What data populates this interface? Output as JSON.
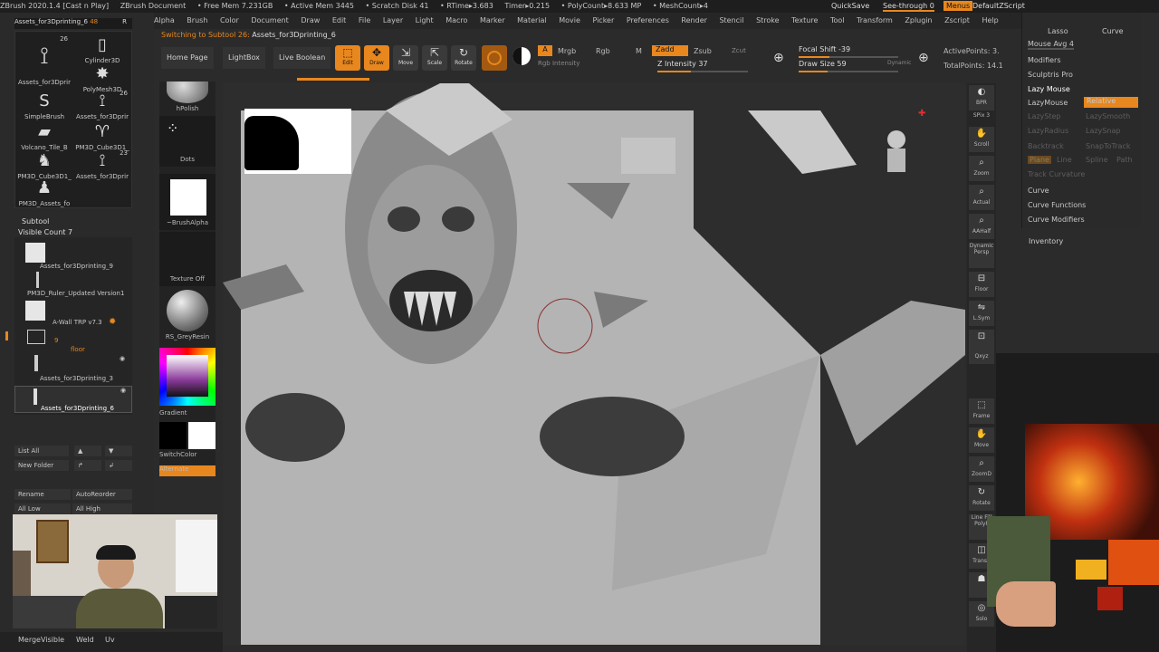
{
  "titlebar": {
    "items": [
      "ZBrush 2020.1.4 [Cast n Play]",
      "ZBrush Document",
      "• Free Mem 7.231GB",
      "• Active Mem 3445",
      "• Scratch Disk 41",
      "• RTime▸3.683",
      "Timer▸0.215",
      "• PolyCount▸8.633 MP",
      "• MeshCount▸4"
    ],
    "quicksave": "QuickSave",
    "see_through": "See-through 0",
    "menus": "Menus",
    "default_script": "DefaultZScript"
  },
  "menubar": {
    "items": [
      "Alpha",
      "Brush",
      "Color",
      "Document",
      "Draw",
      "Edit",
      "File",
      "Layer",
      "Light",
      "Macro",
      "Marker",
      "Material",
      "Movie",
      "Picker",
      "Preferences",
      "Render",
      "Stencil",
      "Stroke",
      "Texture",
      "Tool",
      "Transform",
      "Zplugin",
      "Zscript",
      "Help"
    ]
  },
  "status": {
    "message": "Switching to Subtool 26:",
    "target": "Assets_for3Dprinting_6"
  },
  "tool_header": {
    "name": "Assets_for3Dprinting_6",
    "count": "48",
    "r": "R"
  },
  "tools": [
    {
      "label": "Assets_for3Dprir",
      "count": "26",
      "icon": "spike-icon"
    },
    {
      "label": "Cylinder3D",
      "count": "",
      "icon": "cylinder-icon"
    },
    {
      "label": "",
      "count": "",
      "icon": ""
    },
    {
      "label": "PolyMesh3D",
      "count": "",
      "icon": "star-icon"
    },
    {
      "label": "SimpleBrush",
      "count": "",
      "icon": "s-brush-icon"
    },
    {
      "label": "Assets_for3Dprir",
      "count": "26",
      "icon": "spike-icon"
    },
    {
      "label": "Volcano_Tile_B",
      "count": "",
      "icon": "tile-icon"
    },
    {
      "label": "PM3D_Cube3D1_",
      "count": "",
      "icon": "ram-icon"
    },
    {
      "label": "PM3D_Cube3D1_",
      "count": "",
      "icon": "dragon-icon"
    },
    {
      "label": "Assets_for3Dprir",
      "count": "23",
      "icon": "spike-icon"
    },
    {
      "label": "PM3D_Assets_fo",
      "count": "",
      "icon": "figure-icon"
    }
  ],
  "subtool": {
    "title": "Subtool",
    "visible_count": "Visible Count 7",
    "items": [
      {
        "label": "Assets_for3Dprinting_9"
      },
      {
        "label": "PM3D_Ruler_Updated Version1"
      },
      {
        "label": "A-Wall TRP v7.3"
      },
      {
        "label": "floor",
        "folder_count": "9"
      },
      {
        "label": "Assets_for3Dprinting_3"
      },
      {
        "label": "Assets_for3Dprinting_6"
      }
    ]
  },
  "subtool_buttons": {
    "list_all": "List All",
    "new_folder": "New Folder",
    "rename": "Rename",
    "auto_reorder": "AutoReorder",
    "all_low": "All Low",
    "all_high": "All High",
    "merge_visible": "MergeVisible",
    "weld": "Weld",
    "uv": "Uv"
  },
  "shelf": {
    "hpolish": "hPolish",
    "dots": "Dots",
    "brush_alpha": "~BrushAlpha",
    "texture_off": "Texture Off",
    "material": "RS_GreyResin",
    "gradient": "Gradient",
    "switch_color": "SwitchColor",
    "alternate": "Alternate"
  },
  "toolbar": {
    "home_page": "Home Page",
    "lightbox": "LightBox",
    "live_boolean": "Live Boolean",
    "edit": "Edit",
    "draw": "Draw",
    "move": "Move",
    "scale": "Scale",
    "rotate": "Rotate",
    "a": "A",
    "mrgb": "Mrgb",
    "rgb": "Rgb",
    "m": "M",
    "zadd": "Zadd",
    "zsub": "Zsub",
    "zcut": "Zcut",
    "rgb_intensity": "Rgb Intensity",
    "z_intensity": "Z Intensity 37",
    "z_intensity_value": 37,
    "focal_shift": "Focal Shift -39",
    "focal_shift_value": -39,
    "draw_size": "Draw Size 59",
    "draw_size_value": 59,
    "dynamic": "Dynamic",
    "active_points": "ActivePoints: 3.",
    "total_points": "TotalPoints: 14.1"
  },
  "right_tools": [
    "BPR",
    "SPix 3",
    "Scroll",
    "Zoom",
    "Actual",
    "AAHalf",
    "Dynamic Persp",
    "Floor",
    "L.Sym",
    "",
    "Qxyz",
    "",
    "Frame",
    "Move",
    "ZoomD",
    "Rotate",
    "Line Fill PolyF",
    "Transp",
    "",
    "Solo"
  ],
  "stroke_panel": {
    "lasso": "Lasso",
    "curve_top": "Curve",
    "mouse_avg": "Mouse Avg 4",
    "modifiers": "Modifiers",
    "sculptris_pro": "Sculptris Pro",
    "lazy_mouse": "Lazy Mouse",
    "lazymouse": "LazyMouse",
    "relative": "Relative",
    "lazystep": "LazyStep",
    "lazysmooth": "LazySmooth",
    "lazyradius": "LazyRadius",
    "lazysnap": "LazySnap",
    "backtrack": "Backtrack",
    "snap_to_track": "SnapToTrack",
    "plane": "Plane",
    "line": "Line",
    "spline": "Spline",
    "path": "Path",
    "track_curvature": "Track Curvature",
    "curve": "Curve",
    "curve_functions": "Curve Functions",
    "curve_modifiers": "Curve Modifiers",
    "inventory": "Inventory"
  },
  "colors": {
    "accent": "#e8871e",
    "bg": "#2b2b2b",
    "panel": "#262626"
  }
}
